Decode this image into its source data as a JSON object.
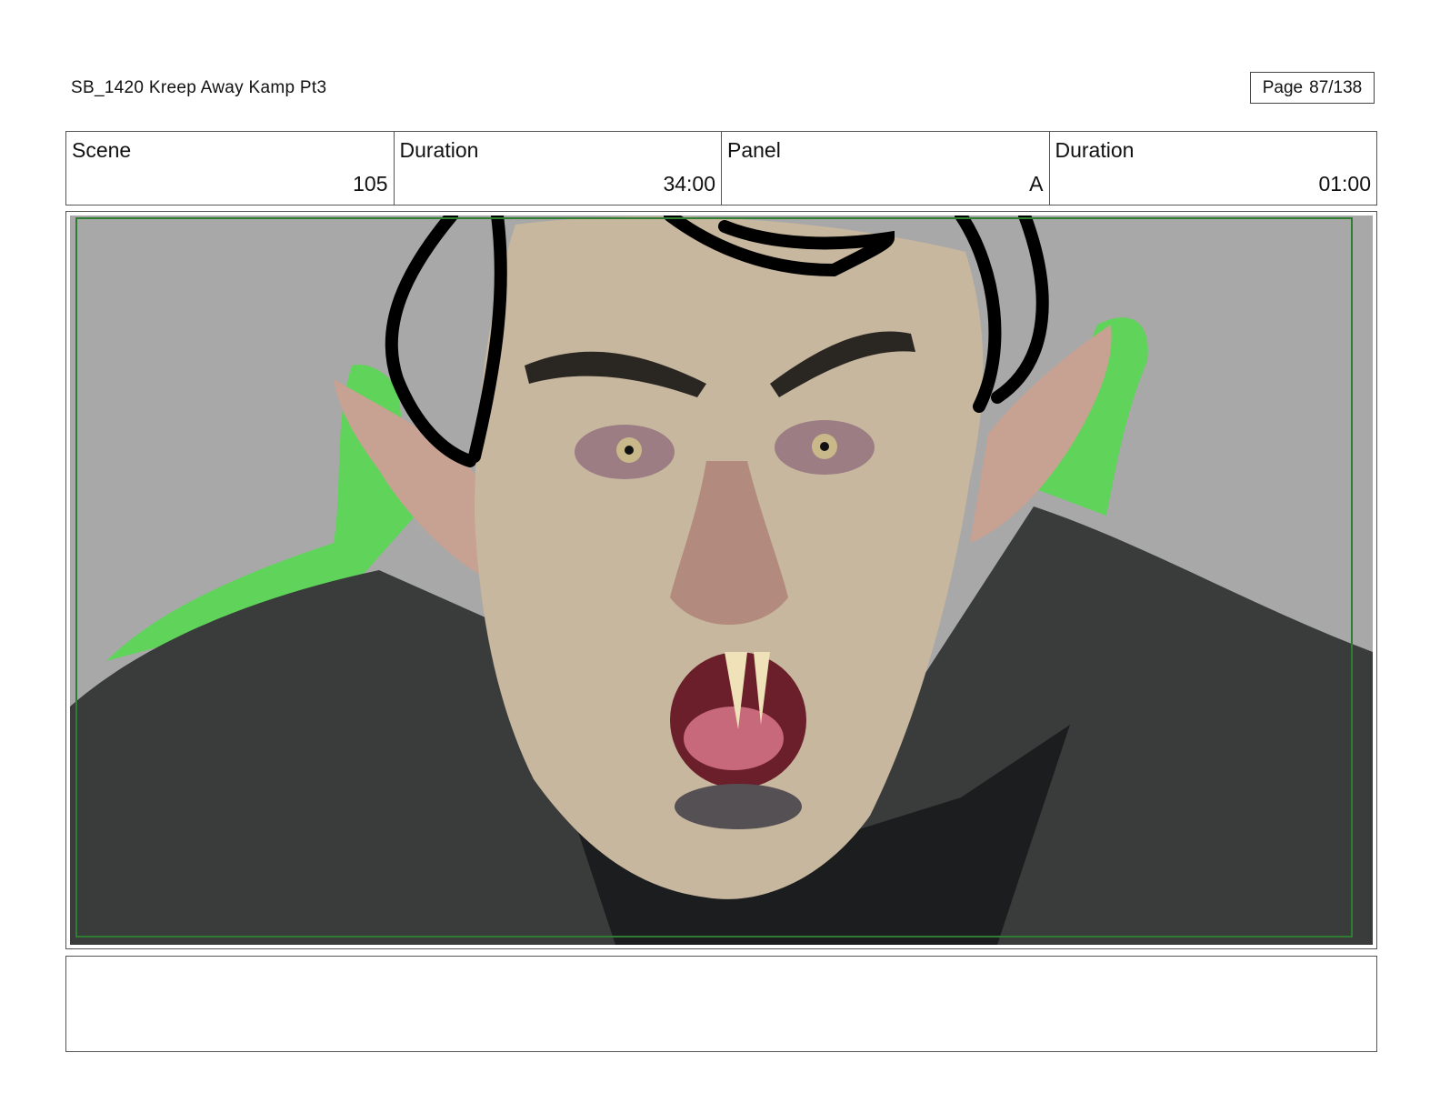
{
  "header": {
    "title": "SB_1420  Kreep Away Kamp Pt3",
    "page_label": "Page",
    "page_number": "87/138"
  },
  "info": {
    "scene_label": "Scene",
    "scene_value": "105",
    "scene_duration_label": "Duration",
    "scene_duration_value": "34:00",
    "panel_label": "Panel",
    "panel_value": "A",
    "panel_duration_label": "Duration",
    "panel_duration_value": "01:00"
  },
  "panel": {
    "background_color": "#a8a8a8",
    "safe_frame_color": "#2e7d32",
    "screen_color": "#5fd35a",
    "coat_color": "#3a3c3b",
    "skin_color": "#c7b79f",
    "hair_sketch_color": "#000000"
  },
  "notes": {
    "text": ""
  }
}
